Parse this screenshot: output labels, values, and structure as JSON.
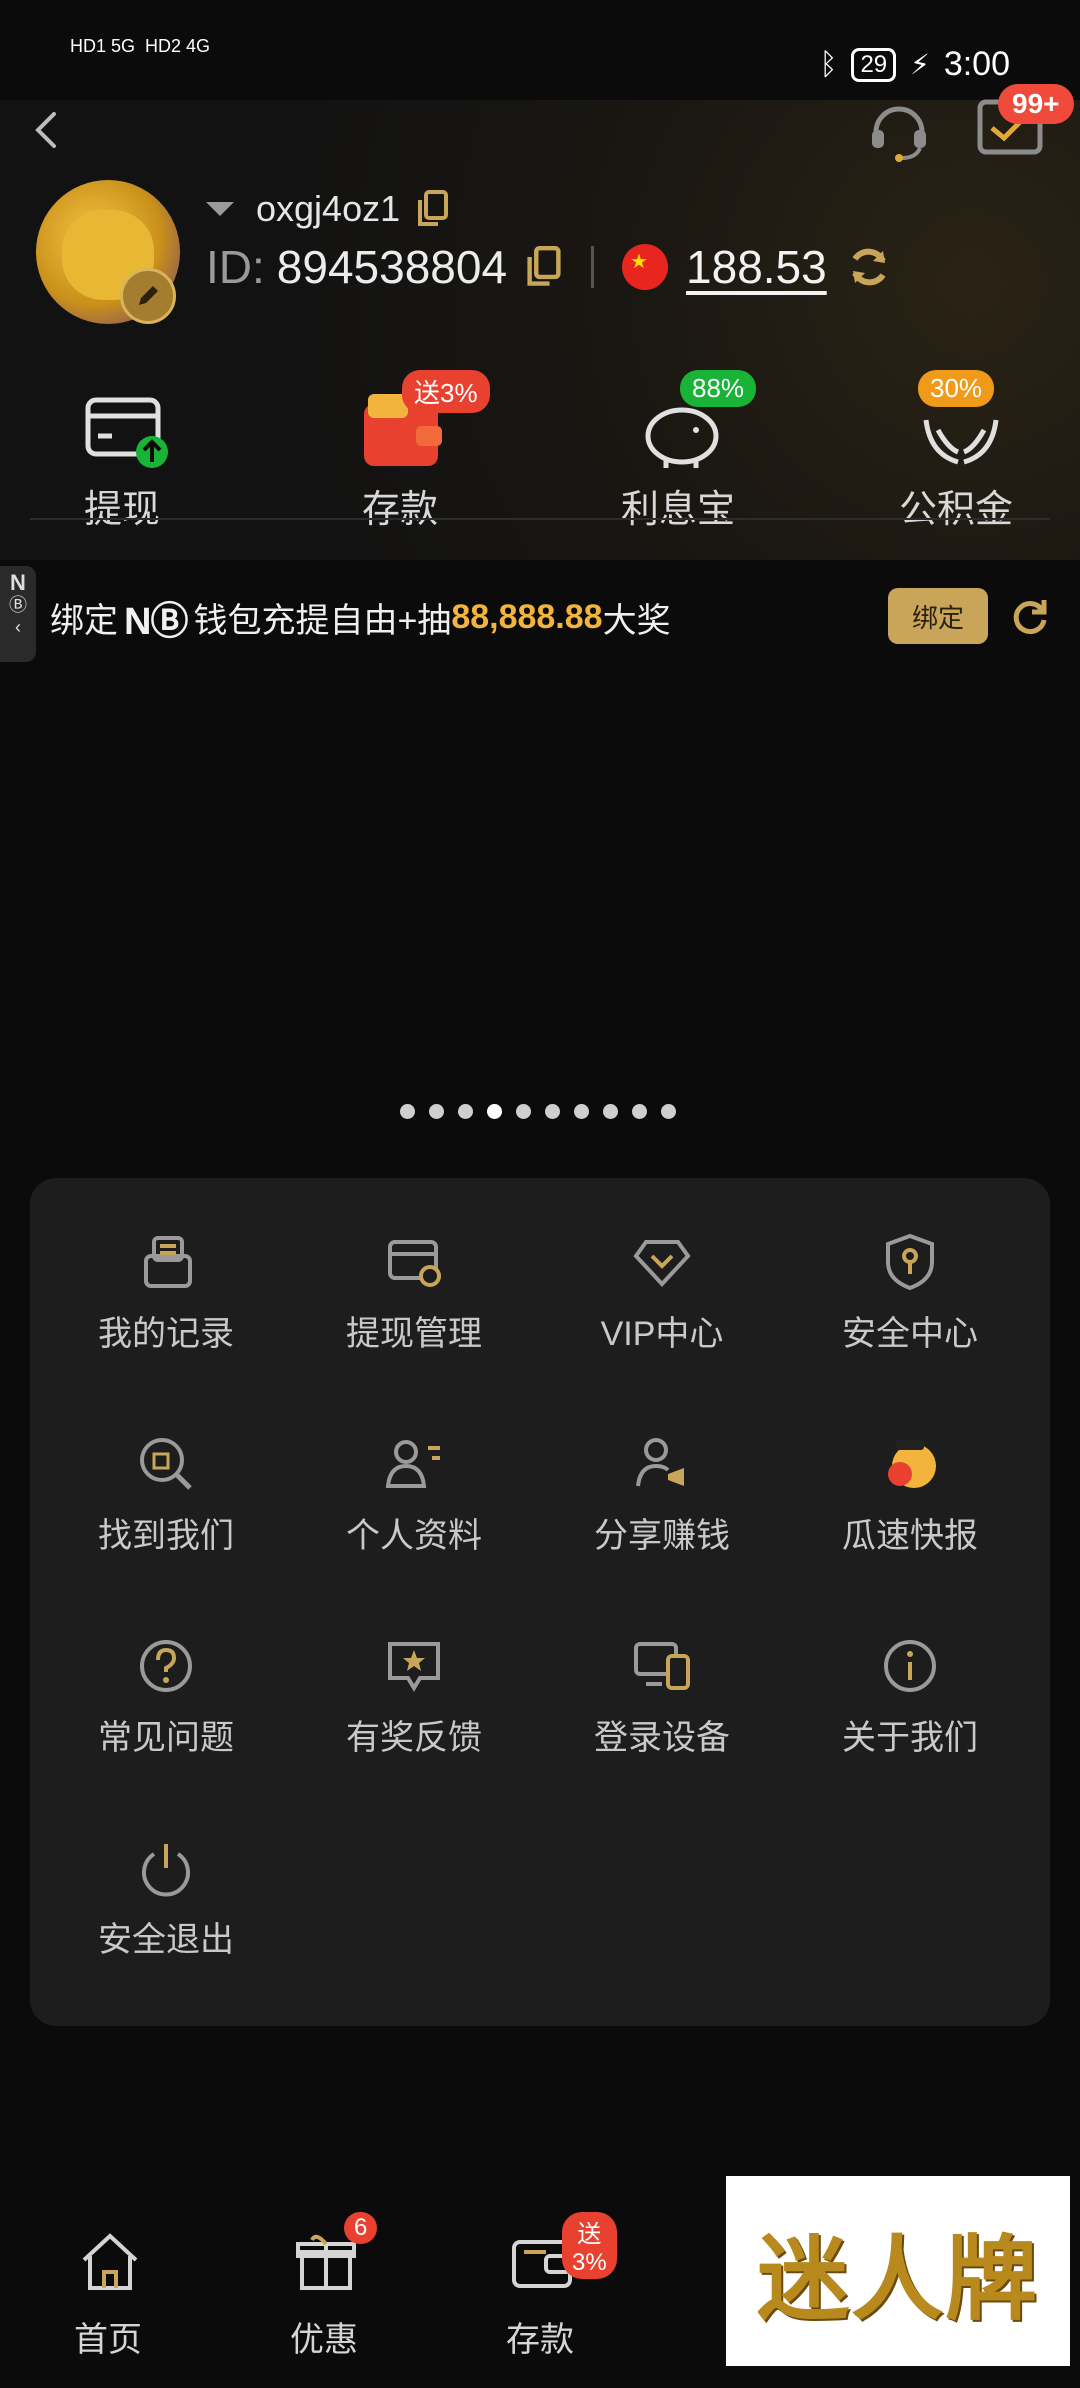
{
  "status_bar": {
    "left": [
      "HD1 5G",
      "HD2 4G"
    ],
    "battery": "29",
    "time": "3:00"
  },
  "header": {
    "message_badge": "99+",
    "username": "oxgj4oz1",
    "id_prefix": "ID:",
    "id_value": "894538804",
    "balance": "188.53"
  },
  "quick_actions": [
    {
      "label": "提现",
      "pill": ""
    },
    {
      "label": "存款",
      "pill": "送3%"
    },
    {
      "label": "利息宝",
      "pill": "88%"
    },
    {
      "label": "公积金",
      "pill": "30%"
    }
  ],
  "side_tab": {
    "text": "N"
  },
  "promo": {
    "pre": "绑定",
    "brand": "NⒷ",
    "mid": "钱包充提自由+抽",
    "amount": "88,888.88",
    "post": "大奖",
    "button": "绑定"
  },
  "carousel": {
    "dot_count": 10,
    "active_index": 3
  },
  "menu": [
    {
      "label": "我的记录",
      "icon": "record-icon"
    },
    {
      "label": "提现管理",
      "icon": "withdraw-manage-icon"
    },
    {
      "label": "VIP中心",
      "icon": "vip-icon"
    },
    {
      "label": "安全中心",
      "icon": "shield-key-icon"
    },
    {
      "label": "找到我们",
      "icon": "find-us-icon"
    },
    {
      "label": "个人资料",
      "icon": "profile-icon"
    },
    {
      "label": "分享赚钱",
      "icon": "share-icon"
    },
    {
      "label": "瓜速快报",
      "icon": "news-mascot-icon"
    },
    {
      "label": "常见问题",
      "icon": "question-icon"
    },
    {
      "label": "有奖反馈",
      "icon": "feedback-star-icon"
    },
    {
      "label": "登录设备",
      "icon": "devices-icon"
    },
    {
      "label": "关于我们",
      "icon": "info-icon"
    },
    {
      "label": "安全退出",
      "icon": "power-icon"
    }
  ],
  "bottom_nav": [
    {
      "label": "首页",
      "badge": ""
    },
    {
      "label": "优惠",
      "badge": "6"
    },
    {
      "label": "存款",
      "badge": "送3%"
    }
  ],
  "watermark": "迷人牌",
  "colors": {
    "background": "#0b0b0b",
    "panel": "#1d1d1d",
    "gold": "#c9a55a",
    "accent_red": "#e84130",
    "accent_green": "#19b337",
    "accent_orange": "#f09a1a",
    "amount_gold": "#f2b43c"
  }
}
